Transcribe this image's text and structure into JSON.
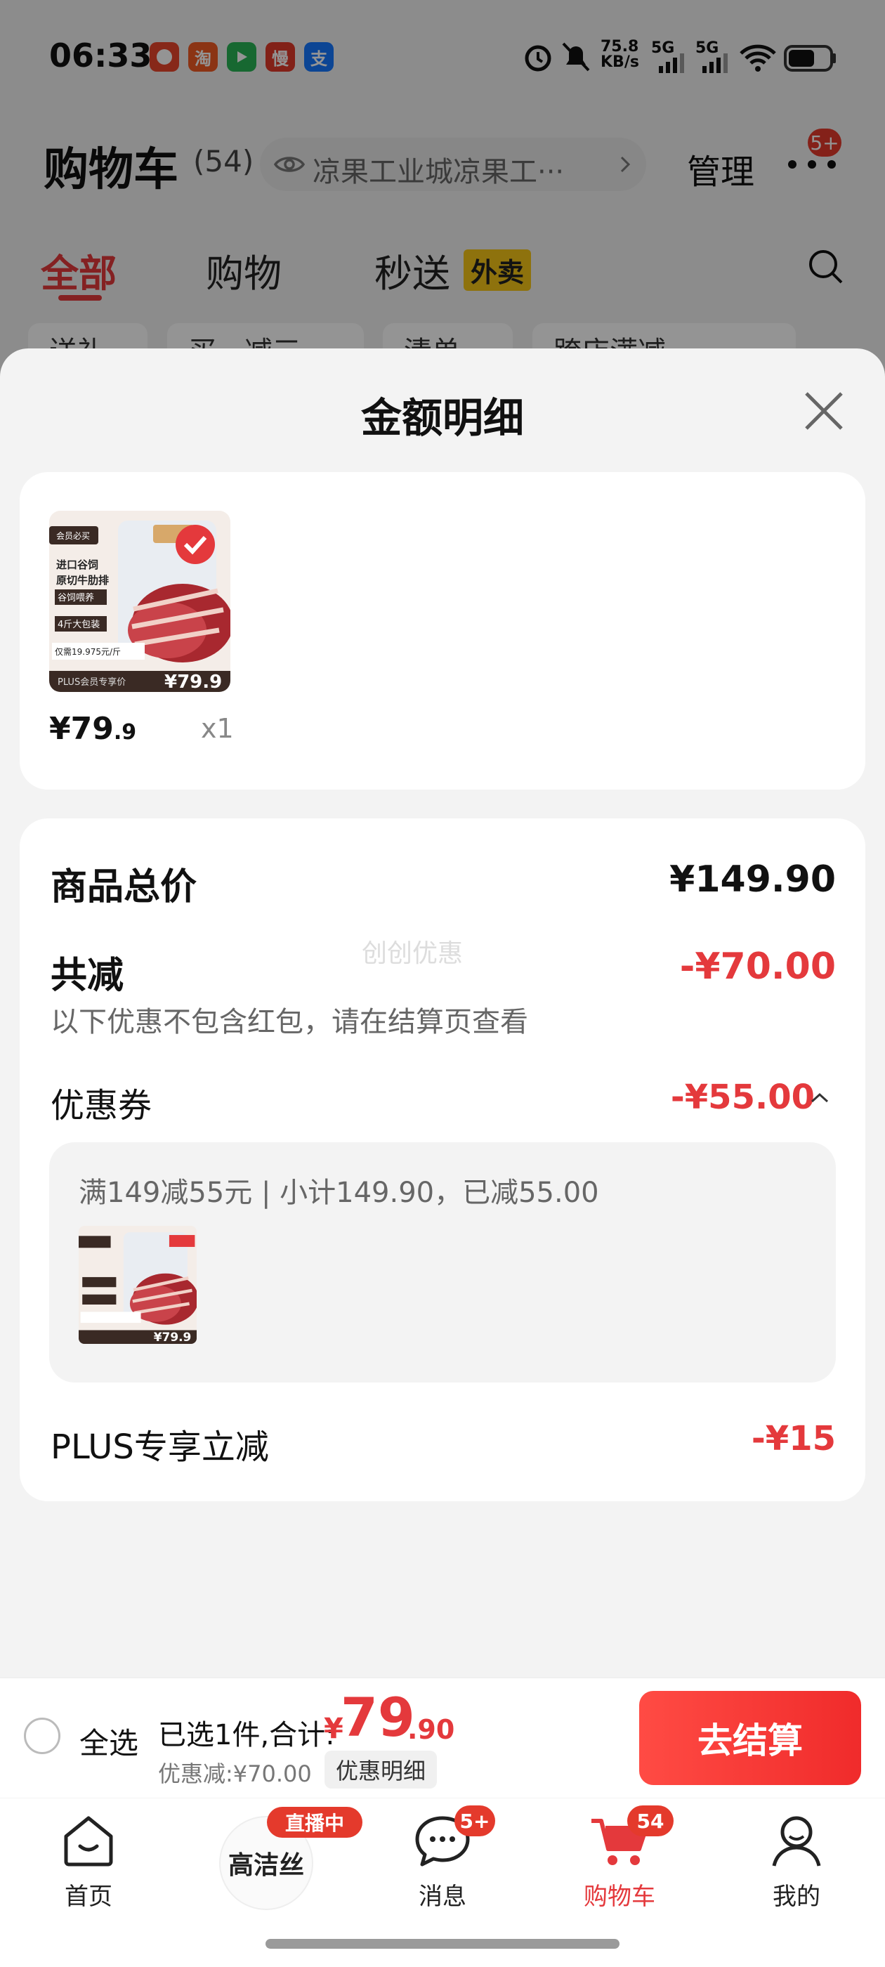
{
  "status_bar": {
    "time": "06:33",
    "net_speed": "75.8 KB/s",
    "signal_1": "5G",
    "signal_2": "5G",
    "app_icons": [
      "taobao-icon",
      "video-icon",
      "slow-icon",
      "alipay-icon"
    ],
    "taobao_char": "淘",
    "slow_char": "慢",
    "alipay_char": "支"
  },
  "header": {
    "title": "购物车",
    "count": "(54)",
    "address": "凉果工业城凉果工···",
    "manage": "管理",
    "more_badge": "5+"
  },
  "tabs": {
    "all": "全部",
    "shopping": "购物",
    "instant": "秒送",
    "takeout": "外卖"
  },
  "filter_chips": [
    "送礼",
    "买一减三",
    "清单",
    "跨店满减"
  ],
  "sheet": {
    "title": "金额明细",
    "product": {
      "price_int": "¥79",
      "price_dec": ".9",
      "qty": "x1",
      "image_price": "¥79.9",
      "image_tag": "PLUS会员专享价",
      "image_lines": [
        "进口谷饲",
        "原切牛肋排",
        "谷饲喂养",
        "4斤大包装",
        "仅需19.975元/斤"
      ],
      "image_badge": "会员必买"
    },
    "total_label": "商品总价",
    "total_value": "¥149.90",
    "reduce_label": "共减",
    "reduce_value": "-¥70.00",
    "note": "以下优惠不包含红包，请在结算页查看",
    "watermark": "创创优惠",
    "coupon_label": "优惠券",
    "coupon_value": "-¥55.00",
    "coupon_detail": "满149减55元 | 小计149.90，已减55.00",
    "plus_label": "PLUS专享立减",
    "plus_value": "-¥15"
  },
  "checkout": {
    "select_all": "全选",
    "selected_label": "已选1件,合计:",
    "yen": "¥",
    "sum_int": "79",
    "sum_dec": ".90",
    "discount": "优惠减:¥70.00",
    "detail_button": "优惠明细",
    "checkout_button": "去结算"
  },
  "bottom_nav": {
    "home": "首页",
    "live_badge": "直播中",
    "live_brand": "高洁丝",
    "messages": "消息",
    "messages_badge": "5+",
    "cart": "购物车",
    "cart_badge": "54",
    "me": "我的"
  },
  "colors": {
    "accent": "#e4393c",
    "checkout_button": "#f02b2b",
    "sheet_bg": "#f3f3f3"
  }
}
